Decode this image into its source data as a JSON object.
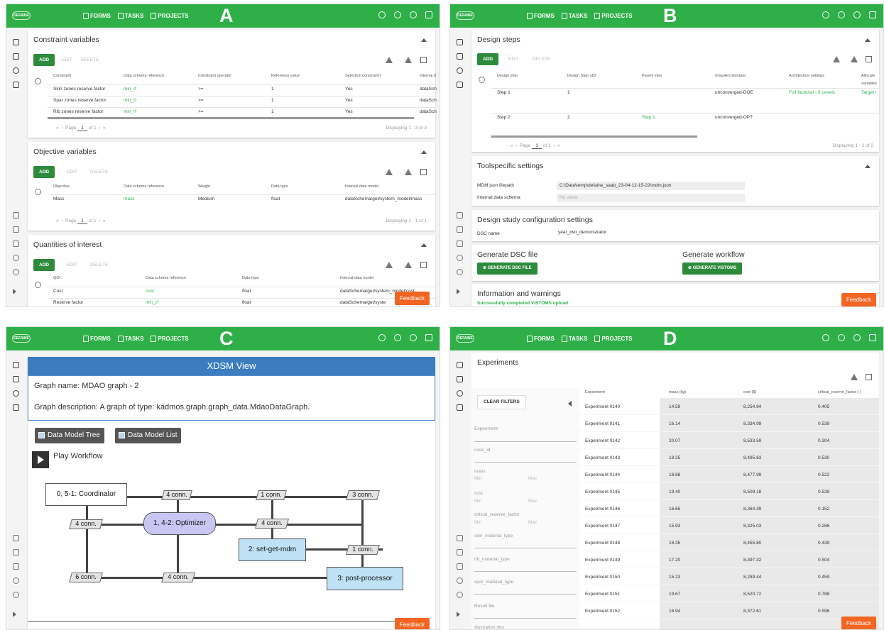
{
  "nav": {
    "logo": "DEFAINE",
    "forms": "FORMS",
    "tasks": "TASKS",
    "projects": "PROJECTS"
  },
  "labels": {
    "a": "A",
    "b": "B",
    "c": "C",
    "d": "D"
  },
  "feedback": "Feedback",
  "common": {
    "add": "ADD",
    "edit": "EDIT",
    "delete": "DELETE",
    "page": "Page",
    "page_num": "1"
  },
  "panelA": {
    "constraint": {
      "title": "Constraint variables",
      "headers": [
        "Constraint",
        "Data schema reference",
        "Constraint operator",
        "Reference value",
        "Selection constraint?",
        "Internal d"
      ],
      "rows": [
        [
          "Skin zones reserve factor",
          "min_rf",
          ">=",
          "1",
          "Yes",
          "dataSch"
        ],
        [
          "Spar zones reserve factor",
          "min_rf",
          ">=",
          "1",
          "Yes",
          "dataSch"
        ],
        [
          "Rib zones reserve factor",
          "min_rf",
          ">=",
          "1",
          "Yes",
          "dataSch"
        ]
      ],
      "of": "of 1",
      "displaying": "Displaying 1 - 3 of 3"
    },
    "objective": {
      "title": "Objective variables",
      "headers": [
        "Objective",
        "Data schema reference",
        "Weight",
        "Data type",
        "Internal data model"
      ],
      "rows": [
        [
          "Mass",
          "mass",
          "Medium",
          "float",
          "dataSchema/get/system_model/mass"
        ]
      ],
      "of": "of 1",
      "displaying": "Displaying 1 - 1 of 1"
    },
    "qoi": {
      "title": "Quantities of interest",
      "headers": [
        "QOI",
        "Data schema reference",
        "Data type",
        "Internal data model"
      ],
      "rows": [
        [
          "Cost",
          "cost",
          "float",
          "dataSchema/get/system_model/cost"
        ],
        [
          "Reserve factor",
          "min_rf",
          "float",
          "dataSchema/get/syste"
        ]
      ]
    }
  },
  "panelB": {
    "design_steps": {
      "title": "Design steps",
      "headers": [
        "Design step",
        "Design Step uID",
        "Parent step",
        "mdaoArchitecture",
        "Architecture settings",
        "Allocate",
        "variables"
      ],
      "rows": [
        [
          "Step 1",
          "1",
          "",
          "unconverged-DOE",
          "Full factorial - 3 Levels",
          "Target r"
        ],
        [
          "Step 2",
          "2",
          "Step 1",
          "unconverged-OPT",
          "",
          ""
        ]
      ],
      "of": "of 1",
      "displaying": "Displaying 1 - 2 of 2"
    },
    "toolspecific": {
      "title": "Toolspecific settings",
      "mdm_label": "MDM json filepath",
      "mdm_value": "C:\\Data\\temp\\defaine_saab_23-04-12-15-22\\mdm.json",
      "schema_label": "Internal data schema",
      "schema_value": "No value"
    },
    "dsc": {
      "title": "Design study configuration settings",
      "name_label": "DSC name",
      "name_value": "year_two_demonstrator"
    },
    "generate": {
      "dsc_title": "Generate DSC file",
      "dsc_btn": "GENERATE DSC FILE",
      "wf_title": "Generate workflow",
      "wf_btn": "GENERATE VISTOMS"
    },
    "info": {
      "title": "Information and warnings",
      "message": "Successfully completed VISTOMS upload"
    }
  },
  "panelC": {
    "header": "XDSM View",
    "graph_name": "Graph name: MDAO graph - 2",
    "graph_desc": "Graph description: A graph of type: kadmos.graph.graph_data.MdaoDataGraph.",
    "btn_tree": "Data Model Tree",
    "btn_list": "Data Model List",
    "play": "Play Workflow",
    "nodes": {
      "coordinator": "0, 5-1: Coordinator",
      "optimizer": "1, 4-2: Optimizer",
      "setget": "2: set-get-mdm",
      "post": "3: post-processor"
    },
    "conns": {
      "c1": "4 conn.",
      "c2": "1 conn.",
      "c3": "3 conn.",
      "c4": "4 conn.",
      "c5": "4 conn.",
      "c6": "1 conn.",
      "c7": "6 conn.",
      "c8": "4 conn."
    }
  },
  "panelD": {
    "title": "Experiments",
    "clear": "CLEAR FILTERS",
    "filters": {
      "experiment": "Experiment",
      "case_id": "case_id",
      "mass": "mass",
      "cost": "cost",
      "crf": "critical_reserve_factor",
      "min": "Min",
      "max": "Max",
      "skin": "skin_material_type",
      "rib": "rib_material_type",
      "spar": "spar_material_type",
      "result": "Result file",
      "illus": "Illustration ribs"
    },
    "headers": [
      "Experiment",
      "mass (kg)",
      "cost ($)",
      "critical_reserve_factor (-)"
    ],
    "rows": [
      [
        "Experiment 0140",
        "14.59",
        "8,254.94",
        "0.405"
      ],
      [
        "Experiment 0141",
        "16.14",
        "8,334.99",
        "0.539"
      ],
      [
        "Experiment 0142",
        "20.07",
        "8,533.59",
        "0.304"
      ],
      [
        "Experiment 0143",
        "19.25",
        "8,495.63",
        "0.530"
      ],
      [
        "Experiment 0144",
        "18.88",
        "8,477.99",
        "0.522"
      ],
      [
        "Experiment 0145",
        "19.40",
        "8,509.18",
        "0.539"
      ],
      [
        "Experiment 0146",
        "16.65",
        "8,364.39",
        "0.152"
      ],
      [
        "Experiment 0147",
        "15.93",
        "8,325.03",
        "0.286"
      ],
      [
        "Experiment 0148",
        "18.35",
        "8,455.80",
        "0.439"
      ],
      [
        "Experiment 0149",
        "17.20",
        "8,397.32",
        "0.504"
      ],
      [
        "Experiment 0150",
        "15.23",
        "8,289.44",
        "0.459"
      ],
      [
        "Experiment 0151",
        "19.67",
        "8,520.72",
        "0.788"
      ],
      [
        "Experiment 0152",
        "16.94",
        "8,372.61",
        "0.596"
      ]
    ]
  }
}
